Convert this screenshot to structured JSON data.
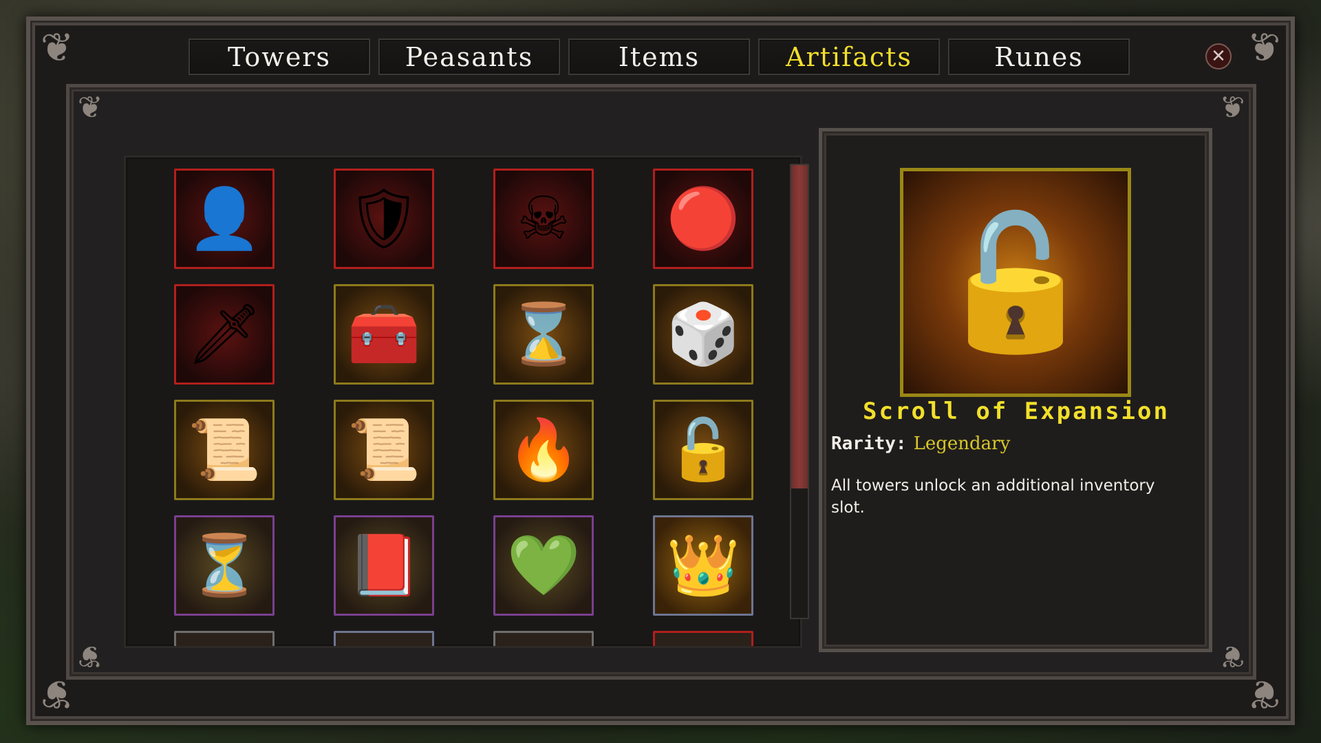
{
  "tabs": [
    {
      "label": "Towers",
      "active": false
    },
    {
      "label": "Peasants",
      "active": false
    },
    {
      "label": "Items",
      "active": false
    },
    {
      "label": "Artifacts",
      "active": true
    },
    {
      "label": "Runes",
      "active": false
    }
  ],
  "close_label": "✕",
  "active_tab_color": "#f2df2b",
  "rarity_colors": {
    "red": "#b21f1c",
    "gold": "#8c7a1c",
    "purple": "#7a3f8f",
    "blue": "#6d7590"
  },
  "artifacts": [
    {
      "icon": "hooded-figure-icon",
      "glyph": "👤",
      "border": "red"
    },
    {
      "icon": "cracked-lava-shield-icon",
      "glyph": "🛡",
      "border": "red"
    },
    {
      "icon": "skull-crossbones-icon",
      "glyph": "☠",
      "border": "red"
    },
    {
      "icon": "red-medallion-icon",
      "glyph": "🔴",
      "border": "red"
    },
    {
      "icon": "green-dagger-icon",
      "glyph": "🗡",
      "border": "red"
    },
    {
      "icon": "treasure-chest-icon",
      "glyph": "🧰",
      "border": "gold"
    },
    {
      "icon": "hourglass-icon",
      "glyph": "⌛",
      "border": "gold"
    },
    {
      "icon": "dice-icon",
      "glyph": "🎲",
      "border": "gold"
    },
    {
      "icon": "rune-scroll-icon",
      "glyph": "📜",
      "border": "gold"
    },
    {
      "icon": "shield-scroll-icon",
      "glyph": "📜",
      "border": "gold"
    },
    {
      "icon": "flame-orb-icon",
      "glyph": "🔥",
      "border": "gold"
    },
    {
      "icon": "unlock-scroll-icon",
      "glyph": "🔓",
      "border": "gold"
    },
    {
      "icon": "golden-hourglass-icon",
      "glyph": "⏳",
      "border": "purple"
    },
    {
      "icon": "helmet-tome-icon",
      "glyph": "📕",
      "border": "purple"
    },
    {
      "icon": "emerald-amulet-icon",
      "glyph": "💚",
      "border": "purple"
    },
    {
      "icon": "golden-crown-icon",
      "glyph": "👑",
      "border": "blue"
    }
  ],
  "selected": {
    "icon": "unlock-scroll-icon",
    "glyph": "🔓",
    "name": "Scroll of Expansion",
    "rarity_label": "Rarity:",
    "rarity_value": "Legendary",
    "description": "All towers unlock an additional inventory slot."
  },
  "scroll_position": 0.0
}
